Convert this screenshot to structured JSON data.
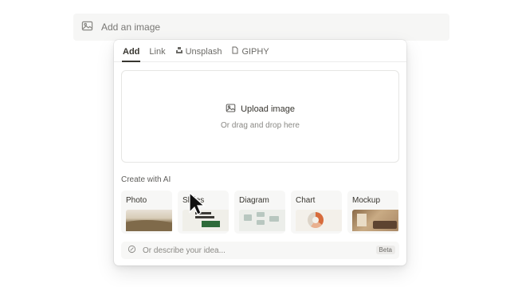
{
  "image_block": {
    "label": "Add an image",
    "icon": "image-icon"
  },
  "tabs": [
    {
      "label": "Add",
      "active": true
    },
    {
      "label": "Link",
      "active": false
    },
    {
      "label": "Unsplash",
      "active": false,
      "icon": "unsplash-icon"
    },
    {
      "label": "GIPHY",
      "active": false,
      "icon": "file-icon"
    }
  ],
  "upload": {
    "button_label": "Upload image",
    "hint": "Or drag and drop here",
    "icon": "image-icon"
  },
  "ai": {
    "title": "Create with AI",
    "cards": [
      {
        "label": "Photo"
      },
      {
        "label": "Slides"
      },
      {
        "label": "Diagram"
      },
      {
        "label": "Chart"
      },
      {
        "label": "Mockup"
      }
    ],
    "input_placeholder": "Or describe your idea...",
    "badge": "Beta",
    "input_icon": "sparkle-icon"
  },
  "colors": {
    "text": "#37352f",
    "muted": "#8a8985",
    "accent_green": "#2e6b3a",
    "chart_orange": "#d76b3b"
  }
}
